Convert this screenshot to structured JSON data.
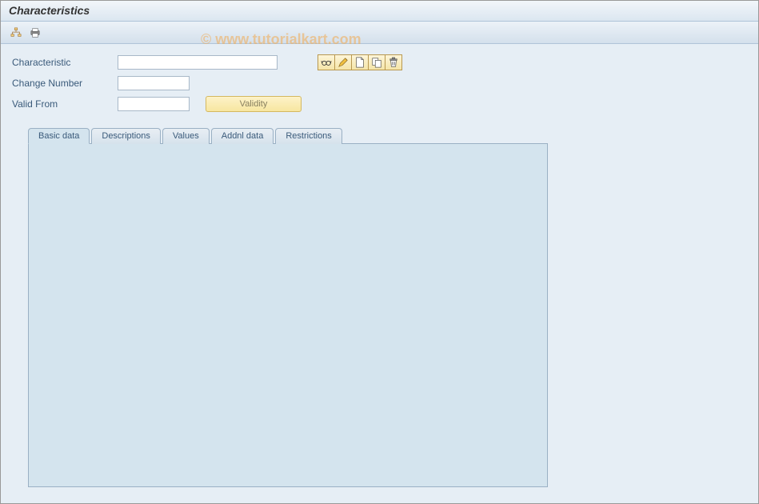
{
  "header": {
    "title": "Characteristics"
  },
  "toolbar": {
    "structure_icon": "structure-icon",
    "print_icon": "print-icon"
  },
  "watermark": "© www.tutorialkart.com",
  "form": {
    "characteristic_label": "Characteristic",
    "characteristic_value": "",
    "change_number_label": "Change Number",
    "change_number_value": "",
    "valid_from_label": "Valid From",
    "valid_from_value": "",
    "validity_button": "Validity"
  },
  "action_icons": {
    "display_icon": "glasses-icon",
    "change_icon": "pencil-icon",
    "create_icon": "page-icon",
    "copy_icon": "copy-icon",
    "delete_icon": "trash-icon"
  },
  "tabs": {
    "items": [
      {
        "label": "Basic data"
      },
      {
        "label": "Descriptions"
      },
      {
        "label": "Values"
      },
      {
        "label": "Addnl data"
      },
      {
        "label": "Restrictions"
      }
    ],
    "active_index": 0
  }
}
